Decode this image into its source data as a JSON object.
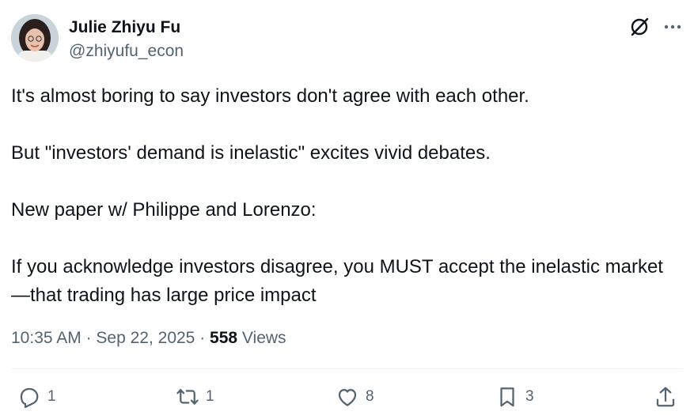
{
  "author": {
    "name": "Julie Zhiyu Fu",
    "handle": "@zhiyufu_econ"
  },
  "tweet": {
    "paragraphs": [
      "It's almost boring to say investors don't agree with each other.",
      "But \"investors' demand is inelastic\" excites vivid debates.",
      "New paper w/ Philippe and Lorenzo:",
      "If you acknowledge investors disagree, you MUST accept the inelastic market—that trading has large price impact"
    ]
  },
  "meta": {
    "time": "10:35 AM",
    "separator": " · ",
    "date": "Sep 22, 2025",
    "views_count": "558",
    "views_label": "Views"
  },
  "actions": {
    "reply_count": "1",
    "repost_count": "1",
    "like_count": "8",
    "bookmark_count": "3"
  },
  "icons": {
    "grok": "grok-icon",
    "more": "more-icon",
    "reply": "reply-icon",
    "repost": "repost-icon",
    "like": "heart-icon",
    "bookmark": "bookmark-icon",
    "share": "share-icon"
  },
  "colors": {
    "text": "#0f1419",
    "secondary": "#536471",
    "divider": "#eff3f4"
  }
}
